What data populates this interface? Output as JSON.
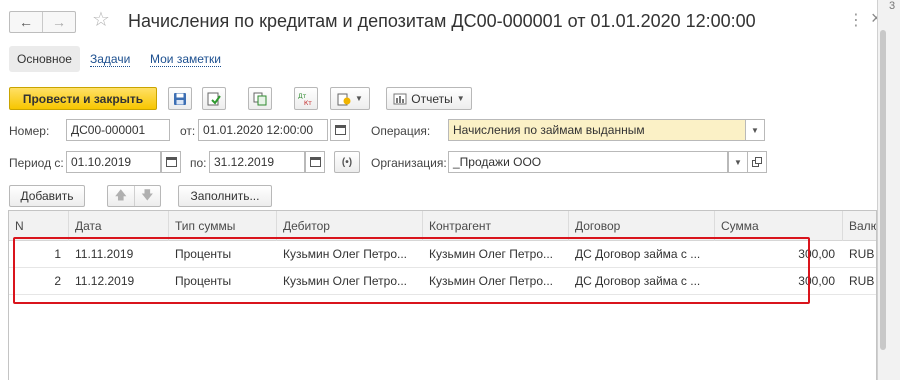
{
  "window": {
    "title": "Начисления по кредитам и депозитам ДС00-000001 от 01.01.2020 12:00:00",
    "back_icon": "arrow-left-icon",
    "forward_icon": "arrow-right-icon",
    "favorite_icon": "star-icon",
    "more_glyph": "⋮",
    "close_glyph": "×",
    "right_panel_digit": "3"
  },
  "tabs": [
    {
      "label": "Основное",
      "active": true
    },
    {
      "label": "Задачи",
      "active": false
    },
    {
      "label": "Мои заметки",
      "active": false
    }
  ],
  "toolbar": {
    "post_close_label": "Провести и закрыть",
    "reports_label": "Отчеты",
    "icons": [
      "save-icon",
      "post-icon",
      "copy-document-icon",
      "dt-kt-icon",
      "create-based-on-icon",
      "reports-icon"
    ],
    "dt_label": "Дт",
    "kt_label": "Кт"
  },
  "form": {
    "number_label": "Номер:",
    "number_value": "ДС00-000001",
    "date_label": "от:",
    "date_value": "01.01.2020 12:00:00",
    "operation_label": "Операция:",
    "operation_value": "Начисления по займам выданным",
    "period_from_label": "Период с:",
    "period_from_value": "01.10.2019",
    "period_to_label": "по:",
    "period_to_value": "31.12.2019",
    "organization_label": "Организация:",
    "organization_value": "_Продажи ООО"
  },
  "table_toolbar": {
    "add_label": "Добавить",
    "fill_label": "Заполнить..."
  },
  "table": {
    "columns": [
      "N",
      "Дата",
      "Тип суммы",
      "Дебитор",
      "Контрагент",
      "Договор",
      "Сумма",
      "Валю"
    ],
    "rows": [
      [
        "1",
        "11.11.2019",
        "Проценты",
        "Кузьмин Олег Петро...",
        "Кузьмин Олег Петро...",
        "ДС Договор займа с ...",
        "300,00",
        "RUB"
      ],
      [
        "2",
        "11.12.2019",
        "Проценты",
        "Кузьмин Олег Петро...",
        "Кузьмин Олег Петро...",
        "ДС Договор займа с ...",
        "300,00",
        "RUB"
      ]
    ]
  },
  "colors": {
    "primary_button": "#f7c600",
    "highlight_border": "#d9141c",
    "link": "#1c4f8f",
    "operation_field_bg": "#fbf1c6"
  }
}
